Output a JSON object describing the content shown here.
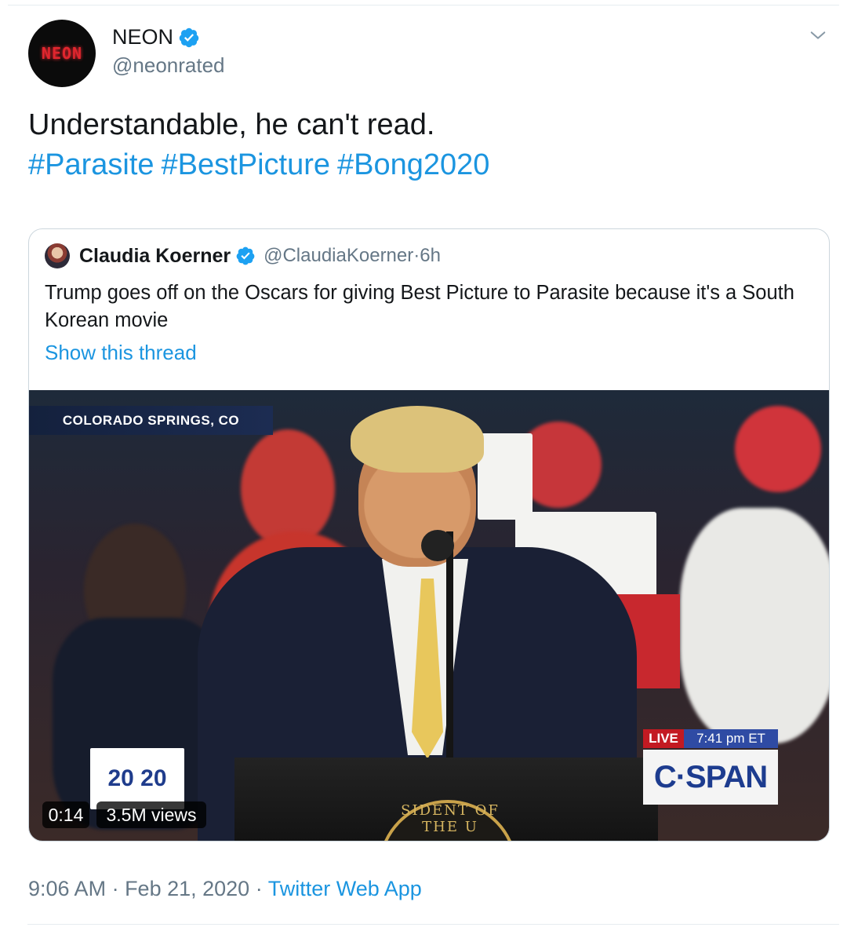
{
  "author": {
    "display_name": "NEON",
    "handle": "@neonrated",
    "avatar_text": "NEON",
    "verified": true
  },
  "tweet": {
    "text": "Understandable, he can't read.",
    "hashtags": [
      "#Parasite",
      "#BestPicture",
      "#Bong2020"
    ]
  },
  "quoted_tweet": {
    "display_name": "Claudia Koerner",
    "handle": "@ClaudiaKoerner",
    "separator": " · ",
    "age": "6h",
    "verified": true,
    "text": "Trump goes off on the Oscars for giving Best Picture to Parasite because it's a South Korean movie",
    "show_thread_label": "Show this thread",
    "video": {
      "location_caption": "COLORADO SPRINGS, CO",
      "live_label": "LIVE",
      "broadcast_time": "7:41 pm ET",
      "network_logo": "C·SPAN",
      "campaign_logo": "20 20",
      "seal_text": "SIDENT OF THE U",
      "duration": "0:14",
      "views": "3.5M views"
    }
  },
  "footer": {
    "time": "9:06 AM",
    "separator": " · ",
    "date": "Feb 21, 2020",
    "source": "Twitter Web App"
  },
  "colors": {
    "link": "#1b95e0",
    "secondary_text": "#657786",
    "verified": "#1da1f2",
    "border": "#ccd6dd"
  },
  "icons": [
    "verified-icon",
    "chevron-down-icon"
  ]
}
